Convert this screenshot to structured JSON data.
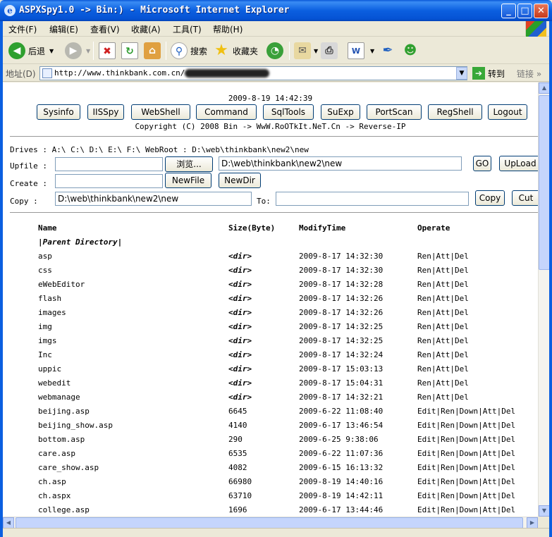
{
  "window": {
    "title": "ASPXSpy1.0 -> Bin:) - Microsoft Internet Explorer",
    "minimize": "_",
    "maximize": "□",
    "close": "✕"
  },
  "menu": [
    "文件(F)",
    "编辑(E)",
    "查看(V)",
    "收藏(A)",
    "工具(T)",
    "帮助(H)"
  ],
  "toolbar": {
    "back": "后退",
    "search": "搜索",
    "favorites": "收藏夹"
  },
  "address": {
    "label": "地址(D)",
    "url": "http://www.thinkbank.com.cn/",
    "go": "转到",
    "links": "链接"
  },
  "page": {
    "datetime": "2009-8-19 14:42:39",
    "nav_buttons": [
      "Sysinfo",
      "IISSpy",
      "WebShell",
      "Command",
      "SqlTools",
      "SuExp",
      "PortScan",
      "RegShell",
      "Logout"
    ],
    "copyright": "Copyright (C) 2008 Bin -> WwW.RoOTkIt.NeT.Cn -> Reverse-IP",
    "drives_line": "Drives : A:\\ C:\\ D:\\ E:\\ F:\\  WebRoot : D:\\web\\thinkbank\\new2\\new",
    "upfile_label": "Upfile :",
    "browse_label": "浏览...",
    "upload_path": "D:\\web\\thinkbank\\new2\\new",
    "go_label": "GO",
    "upload_label": "UpLoad",
    "create_label": "Create :",
    "newfile_label": "NewFile",
    "newdir_label": "NewDir",
    "copy_label": "Copy :",
    "copy_source": "D:\\web\\thinkbank\\new2\\new",
    "to_label": "To:",
    "copy_button": "Copy",
    "cut_button": "Cut"
  },
  "files": {
    "headers": [
      "Name",
      "Size(Byte)",
      "ModifyTime",
      "Operate"
    ],
    "parent": "|Parent Directory|",
    "rows": [
      [
        "asp",
        "<dir>",
        "2009-8-17 14:32:30",
        "Ren|Att|Del"
      ],
      [
        "css",
        "<dir>",
        "2009-8-17 14:32:30",
        "Ren|Att|Del"
      ],
      [
        "eWebEditor",
        "<dir>",
        "2009-8-17 14:32:28",
        "Ren|Att|Del"
      ],
      [
        "flash",
        "<dir>",
        "2009-8-17 14:32:26",
        "Ren|Att|Del"
      ],
      [
        "images",
        "<dir>",
        "2009-8-17 14:32:26",
        "Ren|Att|Del"
      ],
      [
        "img",
        "<dir>",
        "2009-8-17 14:32:25",
        "Ren|Att|Del"
      ],
      [
        "imgs",
        "<dir>",
        "2009-8-17 14:32:25",
        "Ren|Att|Del"
      ],
      [
        "Inc",
        "<dir>",
        "2009-8-17 14:32:24",
        "Ren|Att|Del"
      ],
      [
        "uppic",
        "<dir>",
        "2009-8-17 15:03:13",
        "Ren|Att|Del"
      ],
      [
        "webedit",
        "<dir>",
        "2009-8-17 15:04:31",
        "Ren|Att|Del"
      ],
      [
        "webmanage",
        "<dir>",
        "2009-8-17 14:32:21",
        "Ren|Att|Del"
      ],
      [
        "beijing.asp",
        "6645",
        "2009-6-22 11:08:40",
        "Edit|Ren|Down|Att|Del"
      ],
      [
        "beijing_show.asp",
        "4140",
        "2009-6-17 13:46:54",
        "Edit|Ren|Down|Att|Del"
      ],
      [
        "bottom.asp",
        "290",
        "2009-6-25 9:38:06",
        "Edit|Ren|Down|Att|Del"
      ],
      [
        "care.asp",
        "6535",
        "2009-6-22 11:07:36",
        "Edit|Ren|Down|Att|Del"
      ],
      [
        "care_show.asp",
        "4082",
        "2009-6-15 16:13:32",
        "Edit|Ren|Down|Att|Del"
      ],
      [
        "ch.asp",
        "66980",
        "2009-8-19 14:40:16",
        "Edit|Ren|Down|Att|Del"
      ],
      [
        "ch.aspx",
        "63710",
        "2009-8-19 14:42:11",
        "Edit|Ren|Down|Att|Del"
      ],
      [
        "college.asp",
        "1696",
        "2009-6-17 13:44:46",
        "Edit|Ren|Down|Att|Del"
      ]
    ]
  }
}
